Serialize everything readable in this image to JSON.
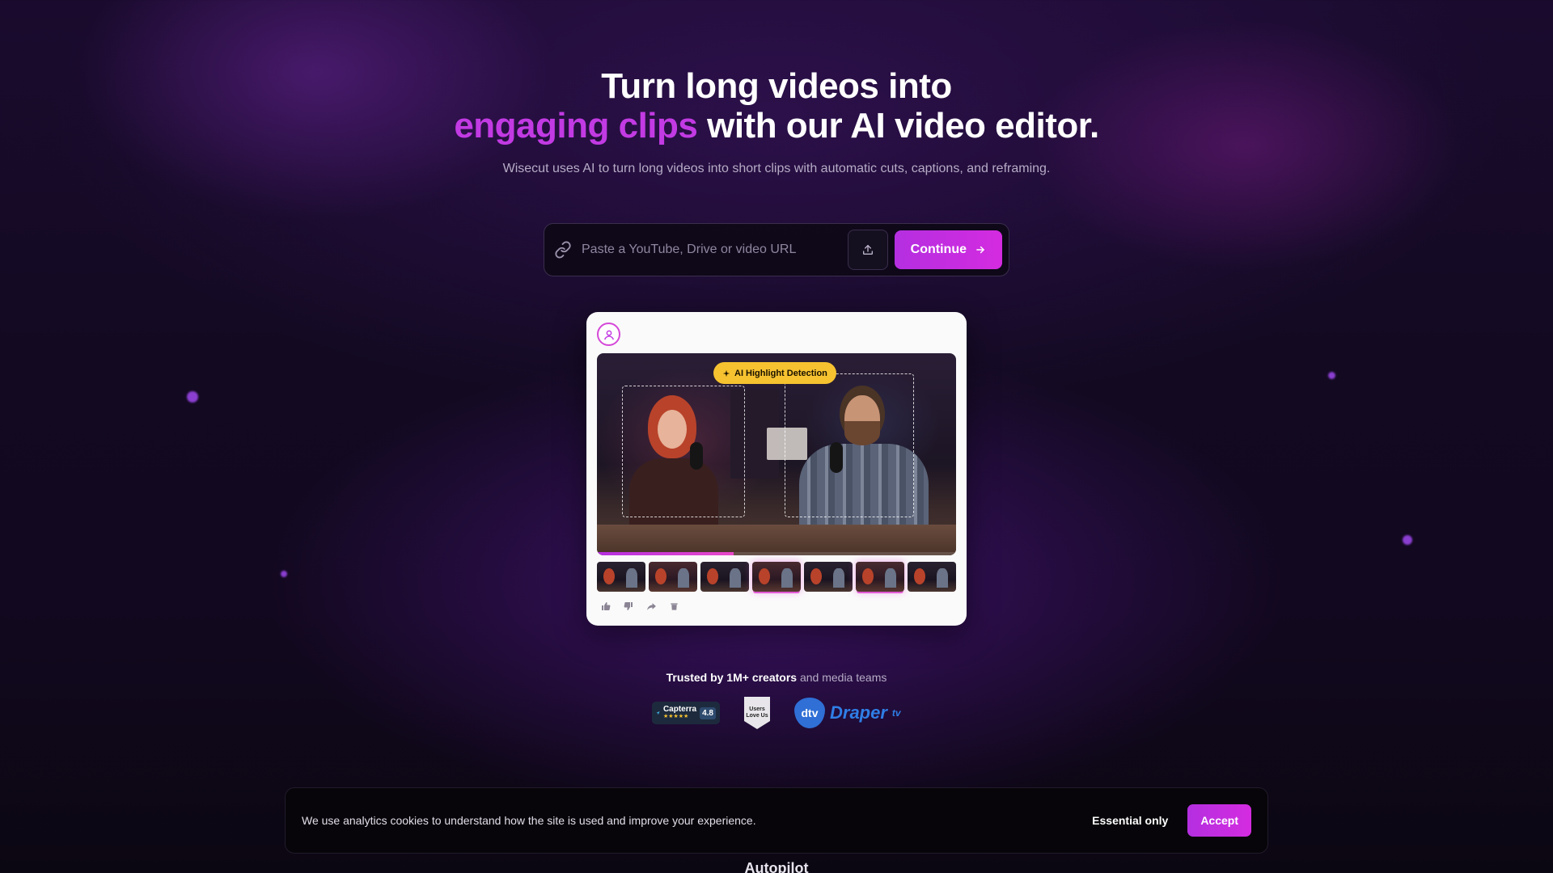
{
  "hero": {
    "title_line1": "Turn long videos into",
    "title_accent": "engaging clips",
    "title_line2_rest": " with our AI video editor.",
    "subtitle": "Wisecut uses AI to turn long videos into short clips with automatic cuts, captions, and reframing."
  },
  "url_bar": {
    "placeholder": "Paste a YouTube, Drive or video URL",
    "value": "",
    "icon": "link-icon",
    "upload_icon": "upload-icon",
    "continue_label": "Continue",
    "continue_icon": "arrow-right-icon"
  },
  "preview": {
    "badge_label": "AI Highlight Detection",
    "badge_icon": "sparkle-icon",
    "progress": 0.38,
    "thumbnails": [
      {
        "active": false,
        "warm": false
      },
      {
        "active": false,
        "warm": true
      },
      {
        "active": false,
        "warm": false
      },
      {
        "active": true,
        "warm": true
      },
      {
        "active": false,
        "warm": false
      },
      {
        "active": true,
        "warm": true
      },
      {
        "active": false,
        "warm": false
      }
    ],
    "actions": [
      "thumbs-up-icon",
      "thumbs-down-icon",
      "share-icon",
      "trash-icon"
    ]
  },
  "trusted": {
    "bold": "Trusted by 1M+ creators",
    "rest": " and media teams"
  },
  "logos": {
    "capterra_name": "Capterra",
    "capterra_stars": "★★★★★",
    "capterra_score": "4.8",
    "ulu_text": "Users Love Us",
    "draper_mark": "dtv",
    "draper_name": "Draper",
    "draper_suffix": "tv"
  },
  "cookie": {
    "text": "We use analytics cookies to understand how the site is used and improve your experience.",
    "essential_label": "Essential only",
    "accept_label": "Accept"
  },
  "next_section": {
    "heading": "Autopilot"
  },
  "colors": {
    "accent": "#c23ae3",
    "button_gradient_start": "#b42fe0",
    "badge": "#f6c230"
  }
}
